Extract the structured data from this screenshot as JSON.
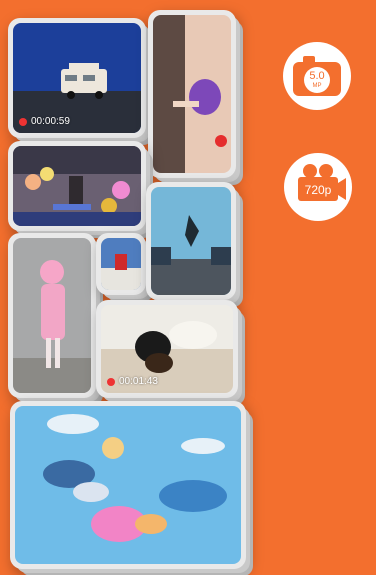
{
  "colors": {
    "background": "#f36f2e",
    "accent": "#f36f2e"
  },
  "badges": {
    "camera": {
      "icon": "camera-icon",
      "megapixels": "5.0",
      "unit": "MP"
    },
    "video": {
      "icon": "video-camera-icon",
      "resolution": "720p"
    }
  },
  "photos": {
    "rv": {
      "timestamp": "00:00:59"
    },
    "dog": {
      "timestamp": "00:01:43"
    }
  }
}
